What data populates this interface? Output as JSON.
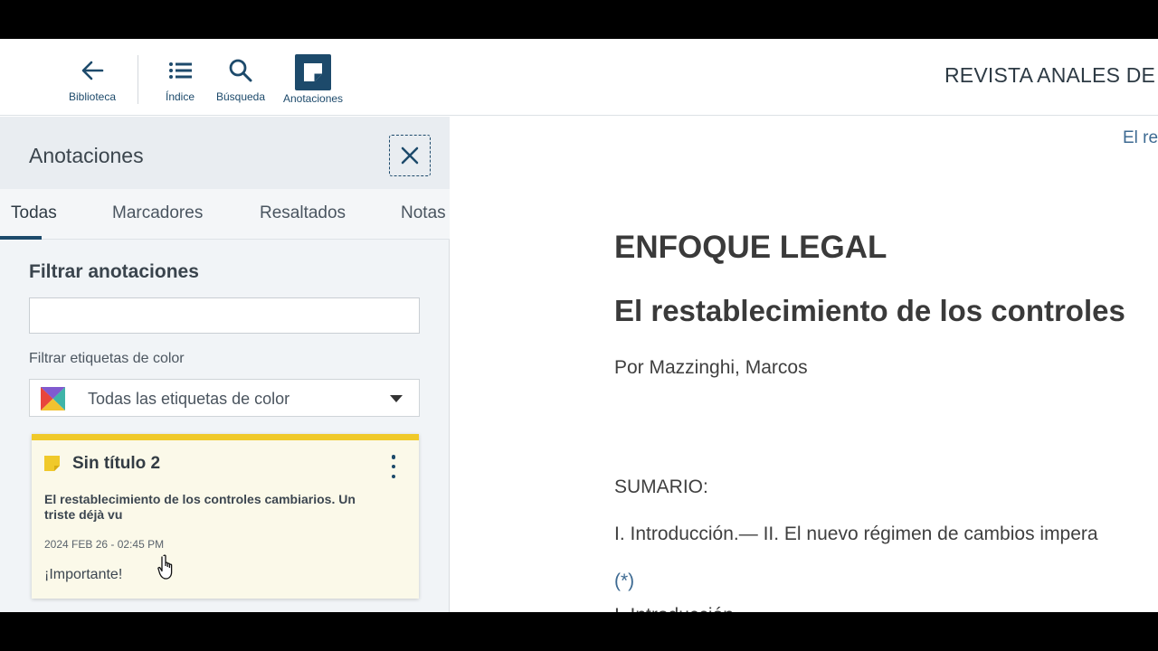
{
  "toolbar": {
    "library_label": "Biblioteca",
    "index_label": "Índice",
    "search_label": "Búsqueda",
    "annotations_label": "Anotaciones",
    "document_title": "REVISTA ANALES DE L"
  },
  "panel": {
    "title": "Anotaciones",
    "tabs": [
      {
        "label": "Todas",
        "active": true
      },
      {
        "label": "Marcadores"
      },
      {
        "label": "Resaltados"
      },
      {
        "label": "Notas"
      }
    ],
    "filter_label": "Filtrar anotaciones",
    "filter_value": "",
    "color_filter_label": "Filtrar etiquetas de color",
    "color_filter_value": "Todas las etiquetas de color",
    "note": {
      "title": "Sin título 2",
      "reference": "El restablecimiento de los controles cambiarios. Un triste déjà vu",
      "date": "2024 FEB 26 - 02:45 PM",
      "text": "¡Importante!",
      "color": "#f0c92a"
    }
  },
  "document": {
    "top_link": "El re",
    "section": "ENFOQUE LEGAL",
    "heading": "El restablecimiento de los controles",
    "author": "Por Mazzinghi, Marcos",
    "sumario": "SUMARIO:",
    "sumario_line": "I. Introducción.— II. El nuevo régimen de cambios impera",
    "footnote_ref": "(*)",
    "next_line": "I. Introducción"
  },
  "colors": {
    "primary": "#1d4a6b",
    "note_yellow": "#f0c92a",
    "panel_bg": "#f1f4f7"
  }
}
